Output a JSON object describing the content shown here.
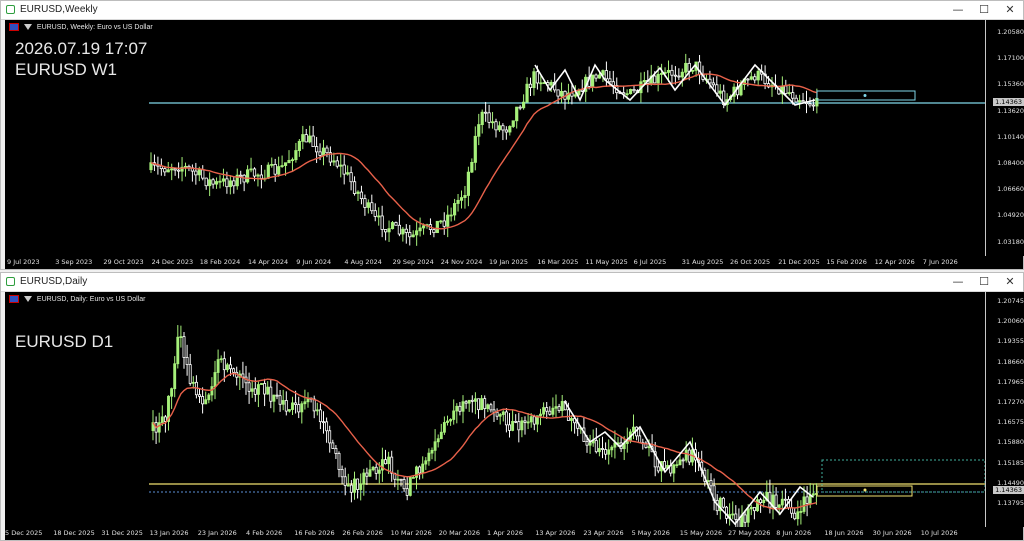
{
  "weekly": {
    "window_title": "EURUSD,Weekly",
    "chart_header": "EURUSD, Weekly:  Euro vs US Dollar",
    "overlay_datetime": "2026.07.19 17:07",
    "overlay_symbol": "EURUSD W1",
    "current_price_tag": "1.14363",
    "price_labels": [
      "1.20580",
      "1.17100",
      "1.15360",
      "1.13620",
      "1.10140",
      "1.08400",
      "1.06660",
      "1.04920",
      "1.03180"
    ],
    "time_labels": [
      "9 Jul 2023",
      "3 Sep 2023",
      "29 Oct 2023",
      "24 Dec 2023",
      "18 Feb 2024",
      "14 Apr 2024",
      "9 Jun 2024",
      "4 Aug 2024",
      "29 Sep 2024",
      "24 Nov 2024",
      "19 Jan 2025",
      "16 Mar 2025",
      "11 May 2025",
      "6 Jul 2025",
      "31 Aug 2025",
      "26 Oct 2025",
      "21 Dec 2025",
      "15 Feb 2026",
      "12 Apr 2026",
      "7 Jun 2026"
    ]
  },
  "daily": {
    "window_title": "EURUSD,Daily",
    "chart_header": "EURUSD, Daily:  Euro vs US Dollar",
    "overlay_symbol": "EURUSD D1",
    "current_price_tag": "1.14363",
    "price_labels": [
      "1.20745",
      "1.20060",
      "1.19355",
      "1.18660",
      "1.17965",
      "1.17270",
      "1.16575",
      "1.15880",
      "1.15185",
      "1.14490",
      "1.13795"
    ],
    "time_labels": [
      "5 Dec 2025",
      "18 Dec 2025",
      "31 Dec 2025",
      "13 Jan 2026",
      "23 Jan 2026",
      "4 Feb 2026",
      "16 Feb 2026",
      "26 Feb 2026",
      "10 Mar 2026",
      "20 Mar 2026",
      "1 Apr 2026",
      "13 Apr 2026",
      "23 Apr 2026",
      "5 May 2026",
      "15 May 2026",
      "27 May 2026",
      "8 Jun 2026",
      "18 Jun 2026",
      "30 Jun 2026",
      "10 Jul 2026"
    ]
  },
  "window_buttons": {
    "minimize": "—",
    "maximize": "☐",
    "close": "✕"
  },
  "colors": {
    "bull": "#a6f07a",
    "bear": "#ffffff",
    "ma": "#e8614a",
    "zigzag": "#ffffff",
    "hline_weekly": "#7fd6e8",
    "hline_daily": "#f0e070",
    "bg": "#000000"
  }
}
